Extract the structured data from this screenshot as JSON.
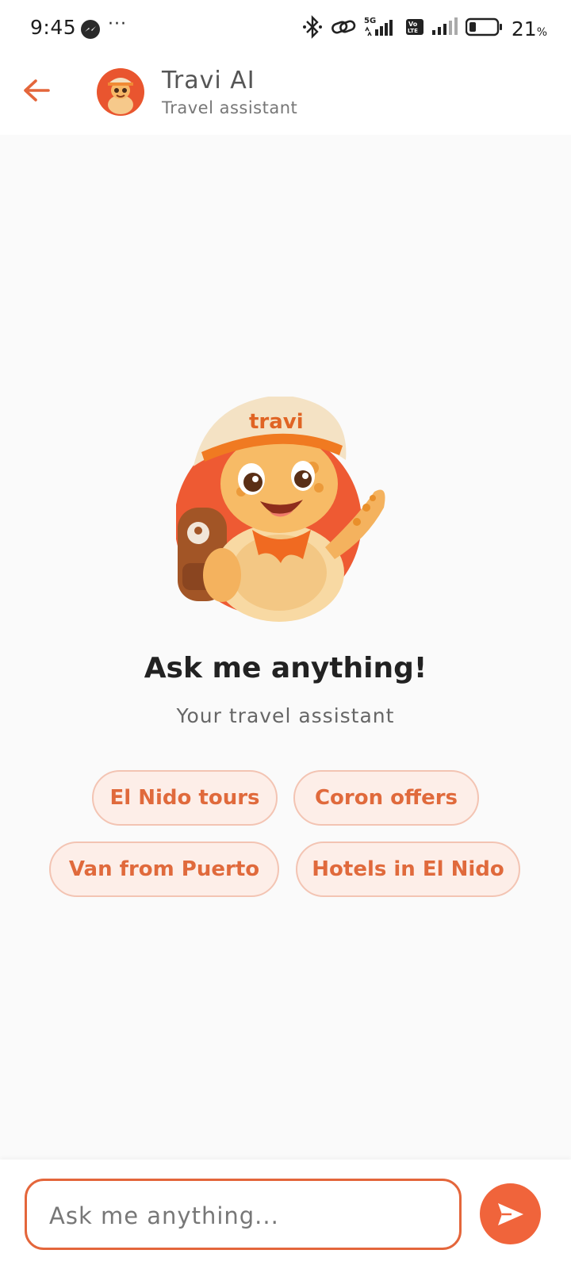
{
  "status_bar": {
    "time": "9:45",
    "dots": "···",
    "network_label": "5G",
    "volte_label": "Vo LTE",
    "battery_percent": "21",
    "battery_unit": "%",
    "battery_level": 0.21
  },
  "header": {
    "title": "Travi AI",
    "subtitle": "Travel assistant",
    "accent_color": "#e4663b"
  },
  "mascot": {
    "hat_text": "travi"
  },
  "main": {
    "headline": "Ask me anything!",
    "subheadline": "Your travel assistant",
    "suggestions": [
      "El Nido tours",
      "Coron offers",
      "Van from Puerto",
      "Hotels in El Nido"
    ]
  },
  "composer": {
    "placeholder": "Ask me anything..."
  },
  "colors": {
    "accent": "#f0643b",
    "chip_bg": "#fdeee8",
    "chip_border": "#f3c4b3",
    "background": "#fafafa"
  }
}
